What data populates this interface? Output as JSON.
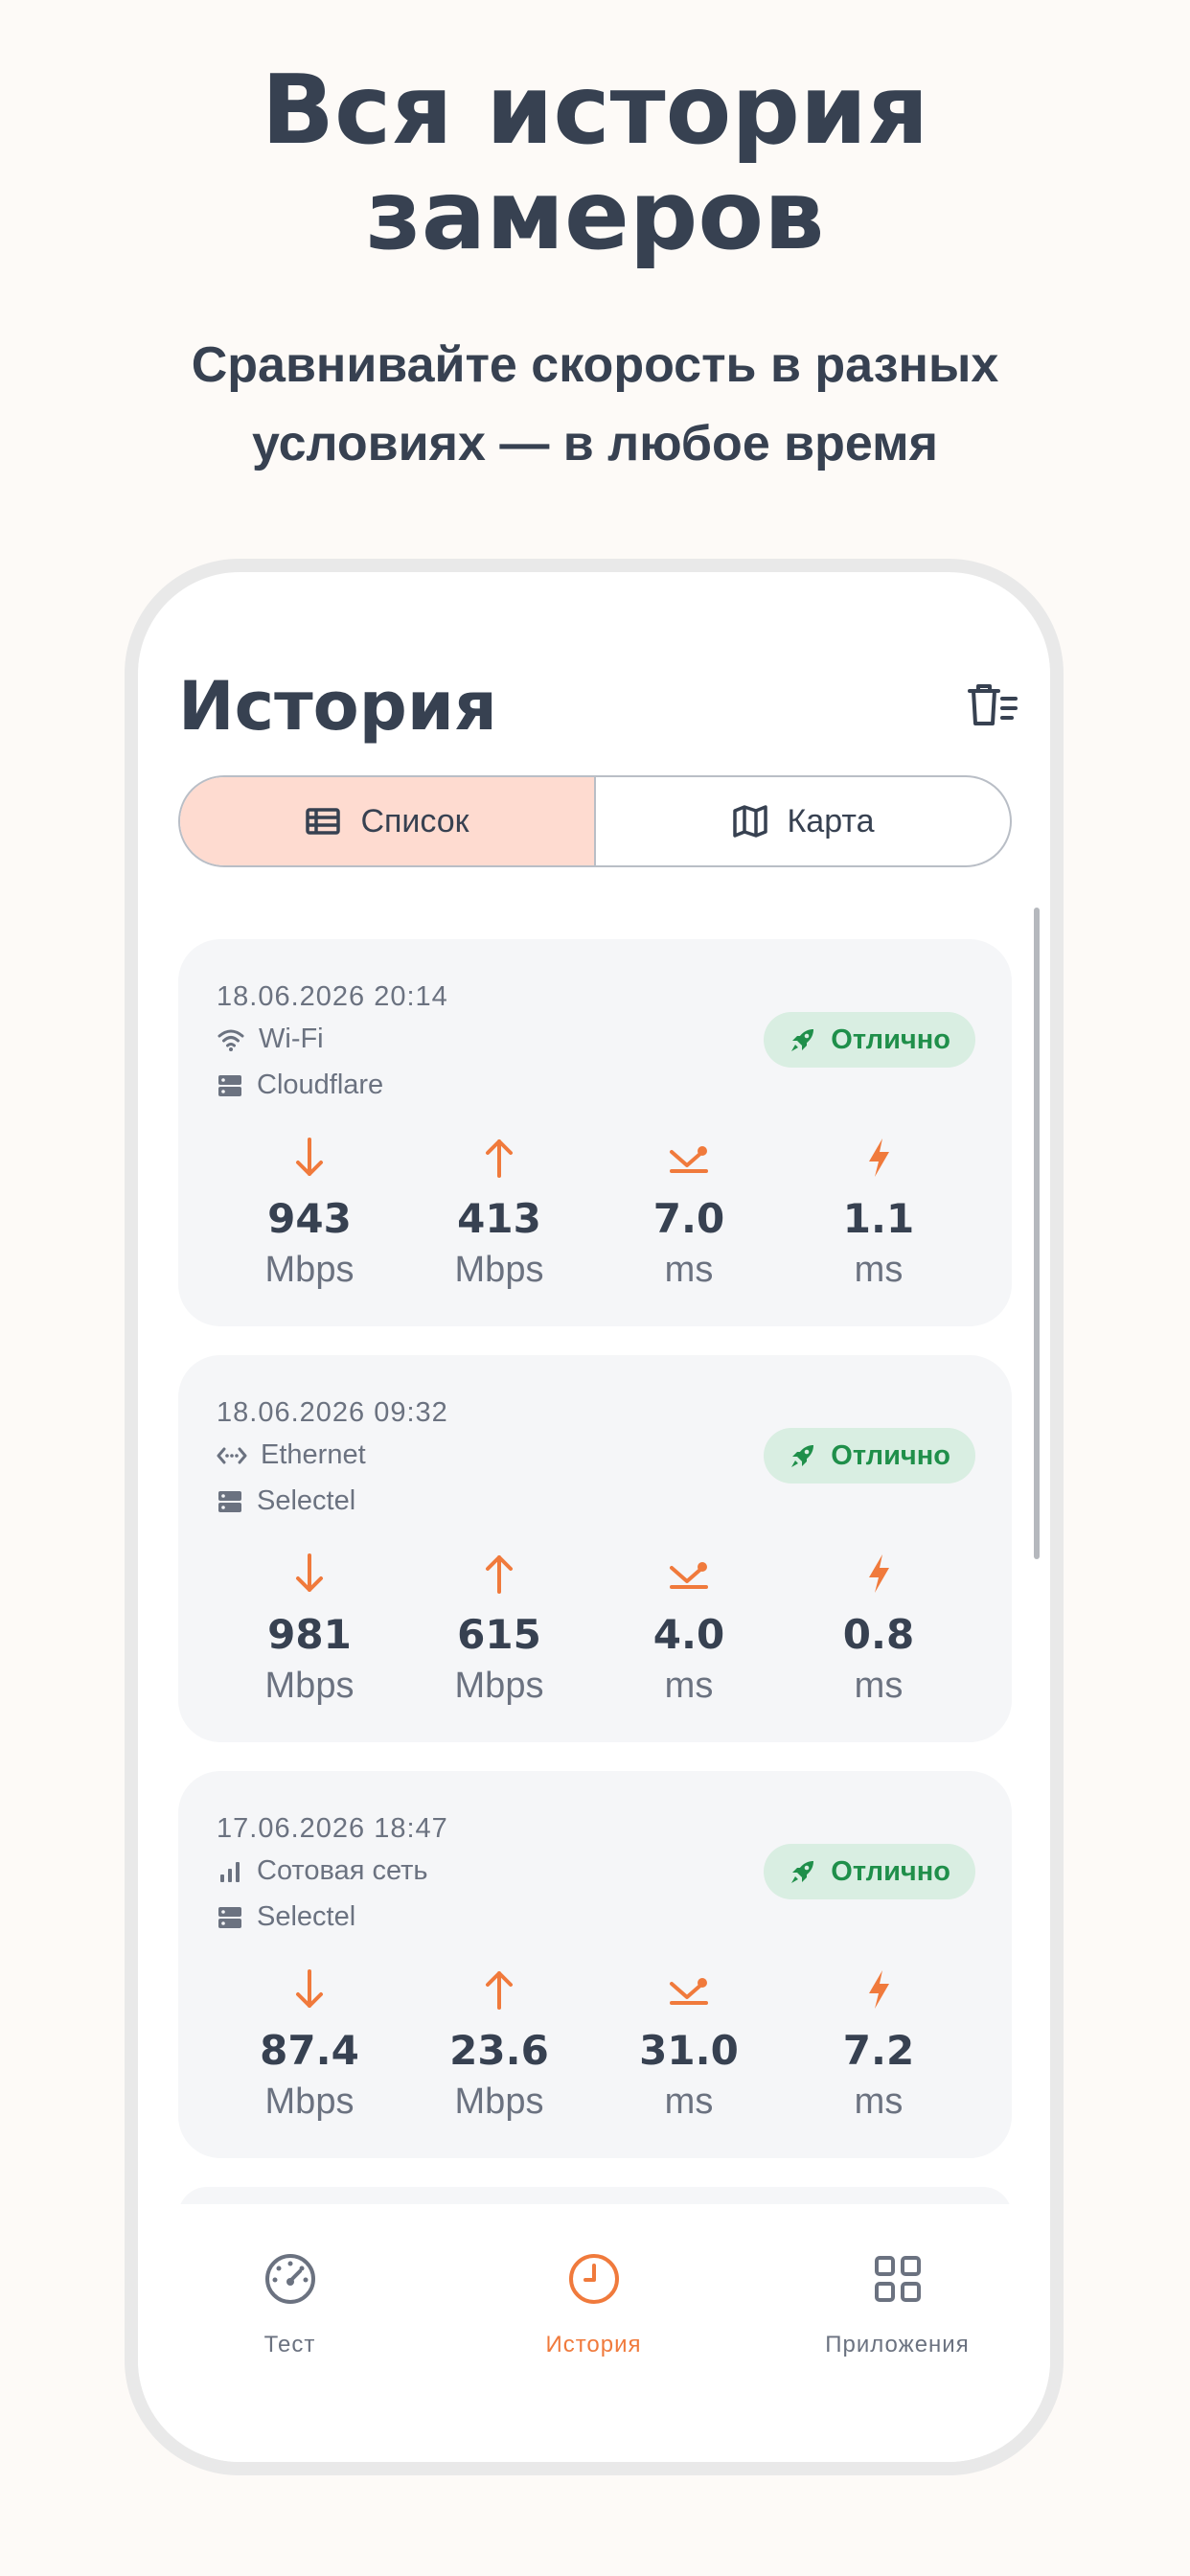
{
  "hero": {
    "title_line1": "Вся история",
    "title_line2": "замеров",
    "subtitle_line1": "Сравнивайте скорость в разных",
    "subtitle_line2": "условиях — в любое время"
  },
  "screen": {
    "title": "История",
    "segments": {
      "list": "Список",
      "map": "Карта",
      "selected": "list"
    },
    "colors": {
      "accent": "#f07a3c",
      "badge_bg": "#d9eee2",
      "badge_text": "#1f8f4a",
      "segment_active": "#fedbd0"
    },
    "cards": [
      {
        "datetime": "18.06.2026 20:14",
        "network": "Wi-Fi",
        "network_icon": "wifi-icon",
        "server": "Cloudflare",
        "badge": "Отлично",
        "download": {
          "value": "943",
          "unit": "Mbps"
        },
        "upload": {
          "value": "413",
          "unit": "Mbps"
        },
        "ping": {
          "value": "7.0",
          "unit": "ms"
        },
        "jitter": {
          "value": "1.1",
          "unit": "ms"
        }
      },
      {
        "datetime": "18.06.2026 09:32",
        "network": "Ethernet",
        "network_icon": "ethernet-icon",
        "server": "Selectel",
        "badge": "Отлично",
        "download": {
          "value": "981",
          "unit": "Mbps"
        },
        "upload": {
          "value": "615",
          "unit": "Mbps"
        },
        "ping": {
          "value": "4.0",
          "unit": "ms"
        },
        "jitter": {
          "value": "0.8",
          "unit": "ms"
        }
      },
      {
        "datetime": "17.06.2026 18:47",
        "network": "Сотовая сеть",
        "network_icon": "cellular-icon",
        "server": "Selectel",
        "badge": "Отлично",
        "download": {
          "value": "87.4",
          "unit": "Mbps"
        },
        "upload": {
          "value": "23.6",
          "unit": "Mbps"
        },
        "ping": {
          "value": "31.0",
          "unit": "ms"
        },
        "jitter": {
          "value": "7.2",
          "unit": "ms"
        }
      }
    ]
  },
  "tabbar": {
    "tabs": [
      {
        "label": "Тест",
        "icon": "speedometer-icon"
      },
      {
        "label": "История",
        "icon": "clock-icon",
        "active": true
      },
      {
        "label": "Приложения",
        "icon": "grid-icon"
      }
    ]
  }
}
